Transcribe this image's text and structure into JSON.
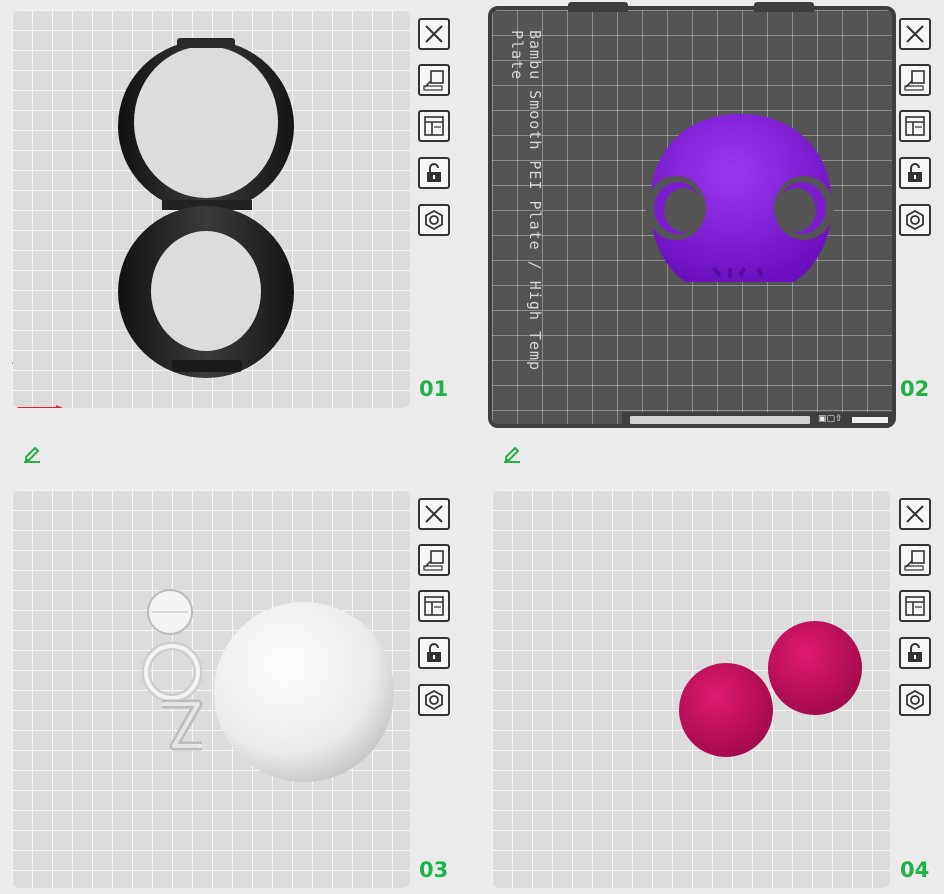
{
  "plates": [
    {
      "number": "01",
      "bed_color": "#dcdcdc",
      "object_color": "#1e1e1e"
    },
    {
      "number": "02",
      "bed_label": "Bambu Smooth PEI Plate / High Temp Plate",
      "bed_color": "#545454",
      "object_color": "#8b1fd8"
    },
    {
      "number": "03",
      "bed_color": "#dcdcdc",
      "object_color": "#ececec"
    },
    {
      "number": "04",
      "bed_color": "#dcdcdc",
      "object_color": "#c8105c"
    }
  ],
  "plate_buttons": [
    "close-icon",
    "auto-arrange-icon",
    "layout-icon",
    "unlock-icon",
    "settings-icon"
  ],
  "accent_color": "#21b14b"
}
